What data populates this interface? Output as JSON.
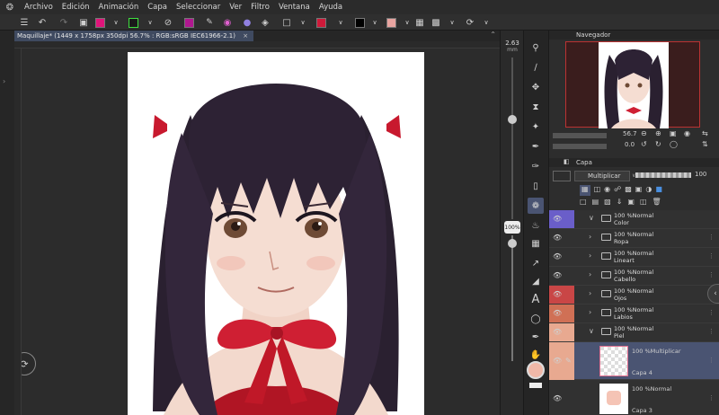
{
  "menu": {
    "items": [
      "Archivo",
      "Edición",
      "Animación",
      "Capa",
      "Seleccionar",
      "Ver",
      "Filtro",
      "Ventana",
      "Ayuda"
    ]
  },
  "document": {
    "tab_title": "Maquillaje* (1449 x 1758px 350dpi 56.7% : RGB:sRGB IEC61966-2.1)"
  },
  "tools": {
    "brush_size": "2.63",
    "brush_unit": "mm",
    "opacity": "100",
    "opacity_unit": "%"
  },
  "navigator": {
    "title": "Navegador",
    "zoom": "56.7",
    "rotation": "0.0"
  },
  "layers_panel": {
    "tab_title": "Capa",
    "blend_mode": "Multiplicar",
    "opacity_value": "100",
    "layers": [
      {
        "pct": "100 %Normal",
        "name": "Color",
        "type": "folder",
        "color": "#6a5ec9",
        "expanded": true
      },
      {
        "pct": "100 %Normal",
        "name": "Ropa",
        "type": "folder",
        "color": "",
        "expanded": false
      },
      {
        "pct": "100 %Normal",
        "name": "Lineart",
        "type": "folder",
        "color": "",
        "expanded": false
      },
      {
        "pct": "100 %Normal",
        "name": "Cabello",
        "type": "folder",
        "color": "",
        "expanded": false
      },
      {
        "pct": "100 %Normal",
        "name": "Ojos",
        "type": "folder",
        "color": "#c94646",
        "expanded": false
      },
      {
        "pct": "100 %Normal",
        "name": "Labios",
        "type": "folder",
        "color": "#d07055",
        "expanded": false
      },
      {
        "pct": "100 %Normal",
        "name": "Piel",
        "type": "folder",
        "color": "#e8a990",
        "expanded": true
      },
      {
        "pct": "100 %Multiplicar",
        "name": "Capa 4",
        "type": "raster",
        "color": "#e8a990",
        "selected": true
      },
      {
        "pct": "100 %Normal",
        "name": "Capa 3",
        "type": "raster",
        "color": "",
        "selected": false
      }
    ]
  },
  "colors": {
    "main": "#f0b8a8",
    "accent_selected": "#4a5472",
    "toolbar_swatch_1": "#e0147a",
    "toolbar_swatch_2": "#b0178f",
    "toolbar_swatch_3": "#cf1a3a",
    "toolbar_swatch_4": "#e8a4a0"
  }
}
